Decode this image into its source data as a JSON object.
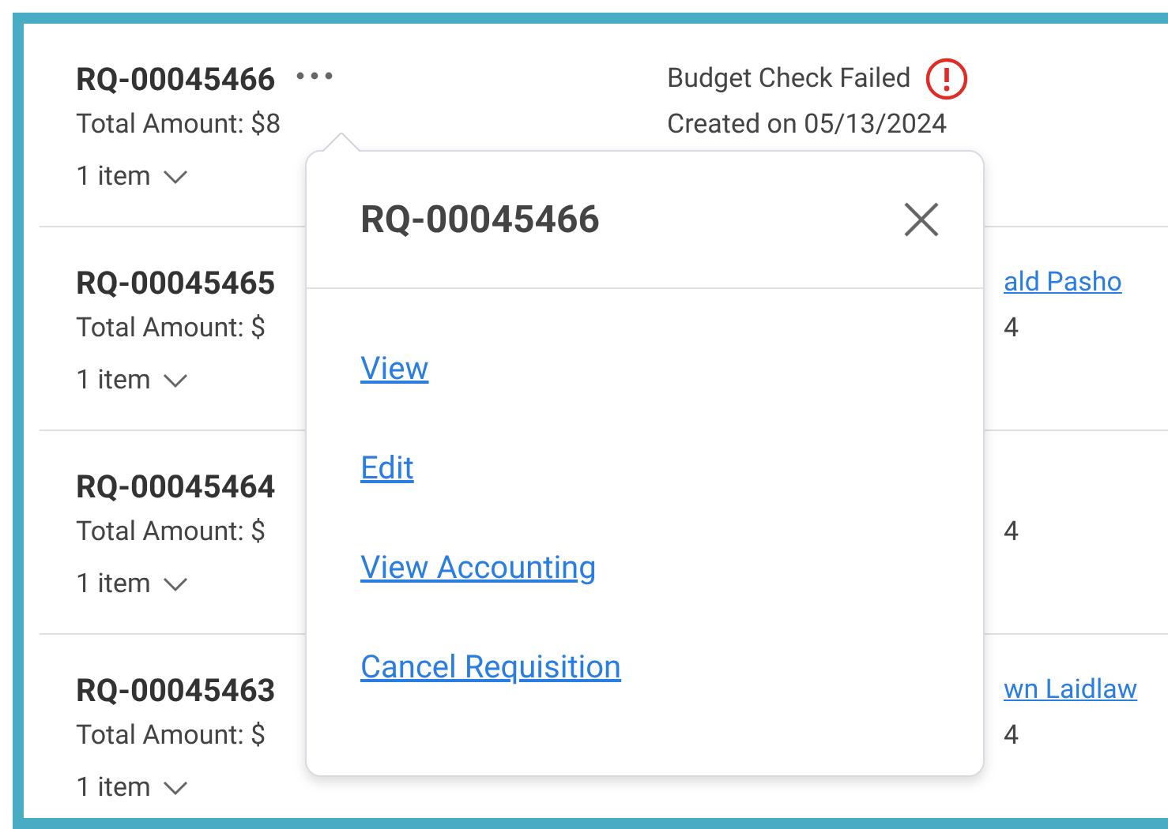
{
  "rows": [
    {
      "id": "RQ-00045466",
      "menu": true,
      "amount": "Total Amount: $8",
      "items": "1 item",
      "status": {
        "text": "Budget Check Failed",
        "kind": "error"
      },
      "created": "Created on 05/13/2024"
    },
    {
      "id": "RQ-00045465",
      "menu": false,
      "amount": "Total Amount: $",
      "items": "1 item",
      "requester": "ald Pasho",
      "created": "4"
    },
    {
      "id": "RQ-00045464",
      "menu": false,
      "amount": "Total Amount: $",
      "items": "1 item",
      "created": "4"
    },
    {
      "id": "RQ-00045463",
      "menu": false,
      "amount": "Total Amount: $",
      "items": "1 item",
      "requester": "wn Laidlaw",
      "created": "4"
    }
  ],
  "popover": {
    "title": "RQ-00045466",
    "actions": [
      "View",
      "Edit",
      "View Accounting",
      "Cancel Requisition"
    ]
  }
}
